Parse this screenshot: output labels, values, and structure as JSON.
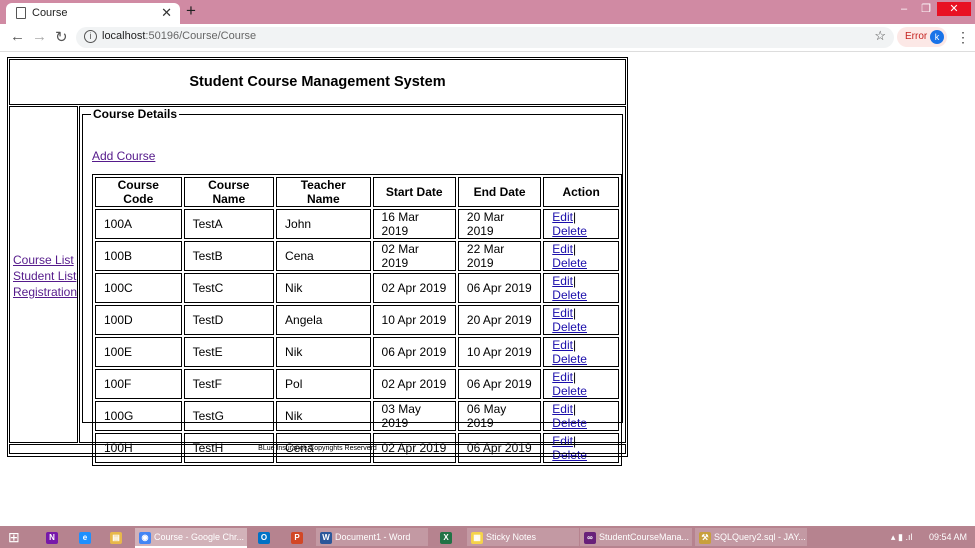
{
  "browser": {
    "tab_title": "Course",
    "new_tab": "+",
    "url_host": "localhost",
    "url_path": ":50196/Course/Course",
    "error_label": "Error",
    "profile_initial": "k"
  },
  "page": {
    "title": "Student Course Management System",
    "sidebar": {
      "course_list": "Course List",
      "student_list": "Student List",
      "registration": "Registration"
    },
    "legend": "Course Details",
    "add_course": "Add Course",
    "columns": [
      "Course Code",
      "Course Name",
      "Teacher Name",
      "Start Date",
      "End Date",
      "Action"
    ],
    "rows": [
      {
        "code": "100A",
        "name": "TestA",
        "teacher": "John",
        "start": "16 Mar 2019",
        "end": "20 Mar 2019"
      },
      {
        "code": "100B",
        "name": "TestB",
        "teacher": "Cena",
        "start": "02 Mar 2019",
        "end": "22 Mar 2019"
      },
      {
        "code": "100C",
        "name": "TestC",
        "teacher": "Nik",
        "start": "02 Apr 2019",
        "end": "06 Apr 2019"
      },
      {
        "code": "100D",
        "name": "TestD",
        "teacher": "Angela",
        "start": "10 Apr 2019",
        "end": "20 Apr 2019"
      },
      {
        "code": "100E",
        "name": "TestE",
        "teacher": "Nik",
        "start": "06 Apr 2019",
        "end": "10 Apr 2019"
      },
      {
        "code": "100F",
        "name": "TestF",
        "teacher": "Pol",
        "start": "02 Apr 2019",
        "end": "06 Apr 2019"
      },
      {
        "code": "100G",
        "name": "TestG",
        "teacher": "Nik",
        "start": "03 May 2019",
        "end": "06 May 2019"
      },
      {
        "code": "100H",
        "name": "TestH",
        "teacher": "Cena",
        "start": "02 Apr 2019",
        "end": "06 Apr 2019"
      }
    ],
    "edit_label": "Edit",
    "sep": "|",
    "delete_label": "Delete",
    "footer": "BLue Insurance Copyrights Reserverd"
  },
  "taskbar": {
    "apps": [
      {
        "name": "onenote",
        "icon": "N",
        "label": ""
      },
      {
        "name": "ie",
        "icon": "e",
        "label": ""
      },
      {
        "name": "explorer",
        "icon": "▤",
        "label": ""
      },
      {
        "name": "chrome",
        "icon": "◉",
        "label": "Course - Google Chr..."
      },
      {
        "name": "outlook",
        "icon": "O",
        "label": ""
      },
      {
        "name": "powerpoint",
        "icon": "P",
        "label": ""
      },
      {
        "name": "word",
        "icon": "W",
        "label": "Document1 - Word"
      },
      {
        "name": "excel",
        "icon": "X",
        "label": ""
      },
      {
        "name": "sticky",
        "icon": "▦",
        "label": "Sticky Notes"
      },
      {
        "name": "visualstudio",
        "icon": "∞",
        "label": "StudentCourseMana..."
      },
      {
        "name": "ssms",
        "icon": "⚒",
        "label": "SQLQuery2.sql - JAY..."
      }
    ],
    "clock": "09:54 AM"
  },
  "colors": {
    "tabstrip": "#d08aa3",
    "taskbar": "#b6838f",
    "link_visited": "#551a8b",
    "link": "#1a0dab"
  }
}
